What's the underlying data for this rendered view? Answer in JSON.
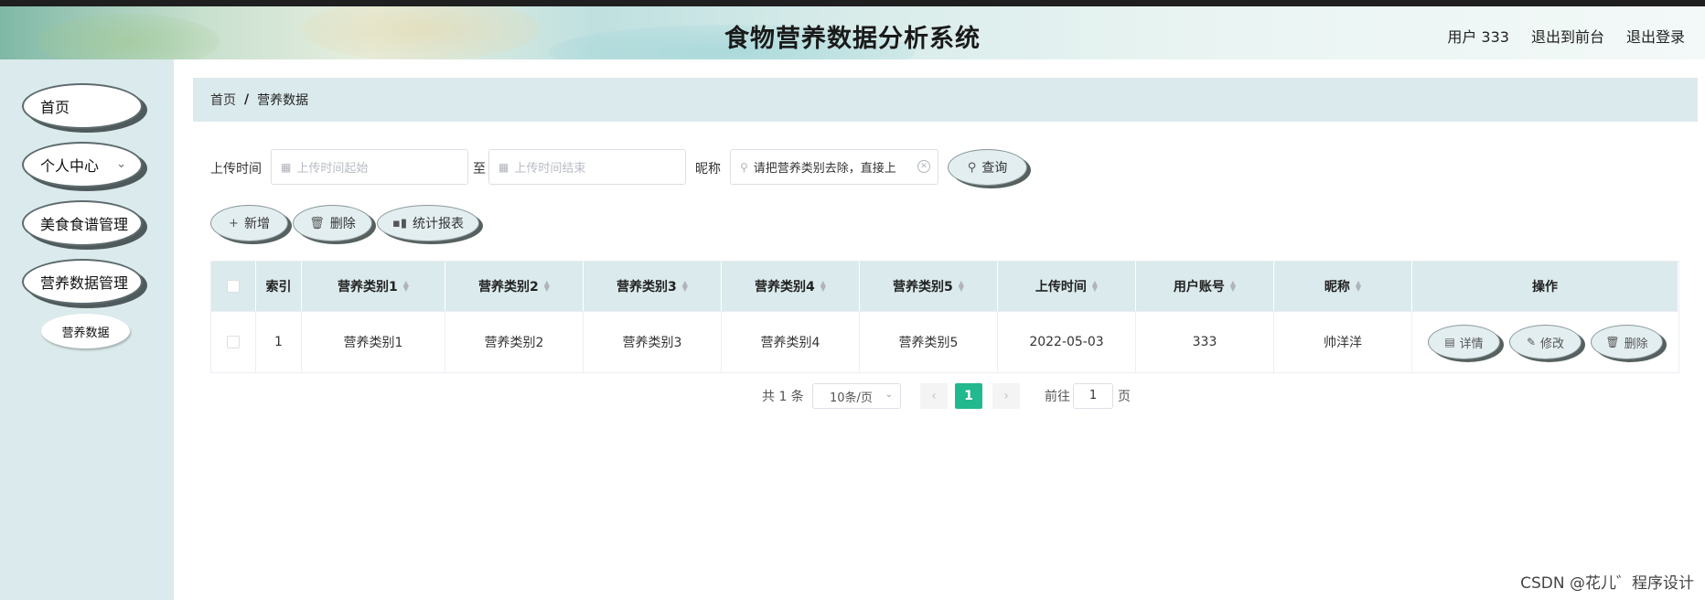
{
  "header": {
    "title": "食物营养数据分析系统",
    "user_label": "用户 333",
    "front_label": "退出到前台",
    "logout_label": "退出登录"
  },
  "sidebar": {
    "items": [
      {
        "label": "首页"
      },
      {
        "label": "个人中心"
      },
      {
        "label": "美食食谱管理"
      },
      {
        "label": "营养数据管理"
      }
    ],
    "sub_item": "营养数据",
    "chevron": "chevron-down-icon"
  },
  "breadcrumb": {
    "home": "首页",
    "separator": "/",
    "current": "营养数据"
  },
  "filters": {
    "upload_time_label": "上传时间",
    "start_placeholder": "上传时间起始",
    "to_label": "至",
    "end_placeholder": "上传时间结束",
    "nickname_label": "昵称",
    "nickname_value": "请把营养类别去除，直接上",
    "query_label": "查询"
  },
  "actions": {
    "add": "新增",
    "delete": "删除",
    "report": "统计报表"
  },
  "table": {
    "columns": [
      "索引",
      "营养类别1",
      "营养类别2",
      "营养类别3",
      "营养类别4",
      "营养类别5",
      "上传时间",
      "用户账号",
      "昵称",
      "操作"
    ],
    "rows": [
      {
        "index": "1",
        "c1": "营养类别1",
        "c2": "营养类别2",
        "c3": "营养类别3",
        "c4": "营养类别4",
        "c5": "营养类别5",
        "time": "2022-05-03",
        "account": "333",
        "nickname": "帅洋洋"
      }
    ],
    "row_actions": {
      "detail": "详情",
      "edit": "修改",
      "delete": "删除"
    }
  },
  "pagination": {
    "total": "共 1 条",
    "page_size": "10条/页",
    "current_page": "1",
    "goto_label": "前往",
    "goto_value": "1",
    "page_suffix": "页"
  },
  "watermark": "CSDN @花儿゛程序设计",
  "colors": {
    "accent": "#22b98f",
    "panel": "#dbeaec",
    "sidebar": "#dbeaec"
  }
}
